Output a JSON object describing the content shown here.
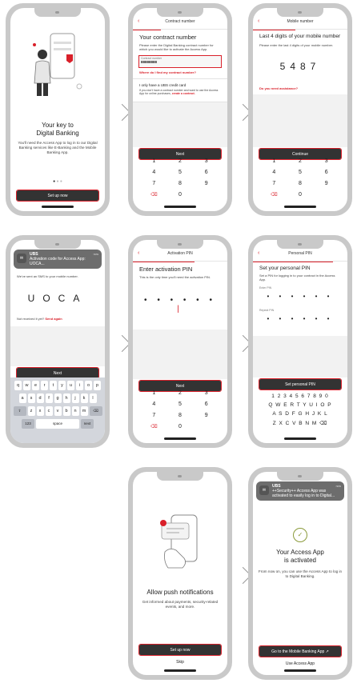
{
  "colors": {
    "accent": "#d9202a",
    "button": "#333333",
    "frame": "#c9c9c9"
  },
  "s1": {
    "title_line1": "Your key to",
    "title_line2": "Digital Banking",
    "body": "You'll need the Access App to log in to our Digital Banking services like E-Banking and the Mobile Banking App.",
    "button": "Set up now"
  },
  "s2": {
    "header": "Contract number",
    "title": "Your contract number",
    "desc": "Please enter the Digital Banking contract number for which you would like to activate the Access App.",
    "field_label": "Contract number",
    "field_value": "88888888",
    "help_link": "Where do I find my contract number?",
    "credit_title": "I only have a UBS credit card",
    "credit_desc": "If you don't have a contract number and want to use the Access App for online purchases,",
    "credit_link": "create a contract.",
    "button": "Next",
    "keys": [
      "1",
      "2",
      "3",
      "4",
      "5",
      "6",
      "7",
      "8",
      "9",
      "⌫",
      "0",
      ""
    ]
  },
  "s3": {
    "header": "Mobile number",
    "title": "Last 4 digits of your mobile number",
    "desc": "Please enter the last 4 digits of your mobile number.",
    "code": "5487",
    "help_link": "Do you need assistance?",
    "button": "Continue",
    "keys": [
      "1",
      "2",
      "3",
      "4",
      "5",
      "6",
      "7",
      "8",
      "9",
      "⌫",
      "0",
      ""
    ]
  },
  "s4": {
    "notif_app": "UBS",
    "notif_time": "now",
    "notif_text": "Activation code for Access App: UOCA...",
    "sms_text": "We've sent an SMS to your mobile number.",
    "code": "UOCA",
    "resend": "Not received it yet?",
    "resend_link": "Send again",
    "button": "Next",
    "kb_row1": [
      "q",
      "w",
      "e",
      "r",
      "t",
      "y",
      "u",
      "i",
      "o",
      "p"
    ],
    "kb_row2": [
      "a",
      "s",
      "d",
      "f",
      "g",
      "h",
      "j",
      "k",
      "l"
    ],
    "kb_row3": [
      "⇧",
      "z",
      "x",
      "c",
      "v",
      "b",
      "n",
      "m",
      "⌫"
    ],
    "kb_num": "123",
    "kb_space": "space",
    "kb_next": "next"
  },
  "s5": {
    "header": "Activation PIN",
    "title": "Enter activation PIN",
    "desc": "This is the only time you'll need the activation PIN.",
    "dots": "• • • • • • ",
    "button": "Next",
    "keys": [
      "1",
      "2",
      "3",
      "4",
      "5",
      "6",
      "7",
      "8",
      "9",
      "⌫",
      "0",
      ""
    ]
  },
  "s6": {
    "header": "Personal PIN",
    "title": "Set your personal PIN",
    "desc": "Set a PIN for logging in to your contract in the Access App.",
    "enter_label": "Enter PIN",
    "repeat_label": "Repeat PIN",
    "dots": "• • • • • •",
    "button": "Set personal PIN",
    "row_num": "1 2 3 4 5 6 7 8 9 0",
    "row_q": "Q W E R T Y U I O P",
    "row_a": "A S D F G H J K L",
    "row_z": "Z X C V B N M ⌫"
  },
  "s7": {
    "title": "Allow push notifications",
    "body": "Get informed about payments, security-related events, and more.",
    "button": "Set up now",
    "skip": "Skip"
  },
  "s8": {
    "notif_app": "UBS",
    "notif_time": "now",
    "notif_text": "++Security++ Access App was activated to easily log in to Digital...",
    "title_line1": "Your Access App",
    "title_line2": "is activated",
    "body": "From now on, you can use the Access App to log in to Digital Banking.",
    "button": "Go to the Mobile Banking App ↗",
    "secondary": "Use Access App"
  }
}
